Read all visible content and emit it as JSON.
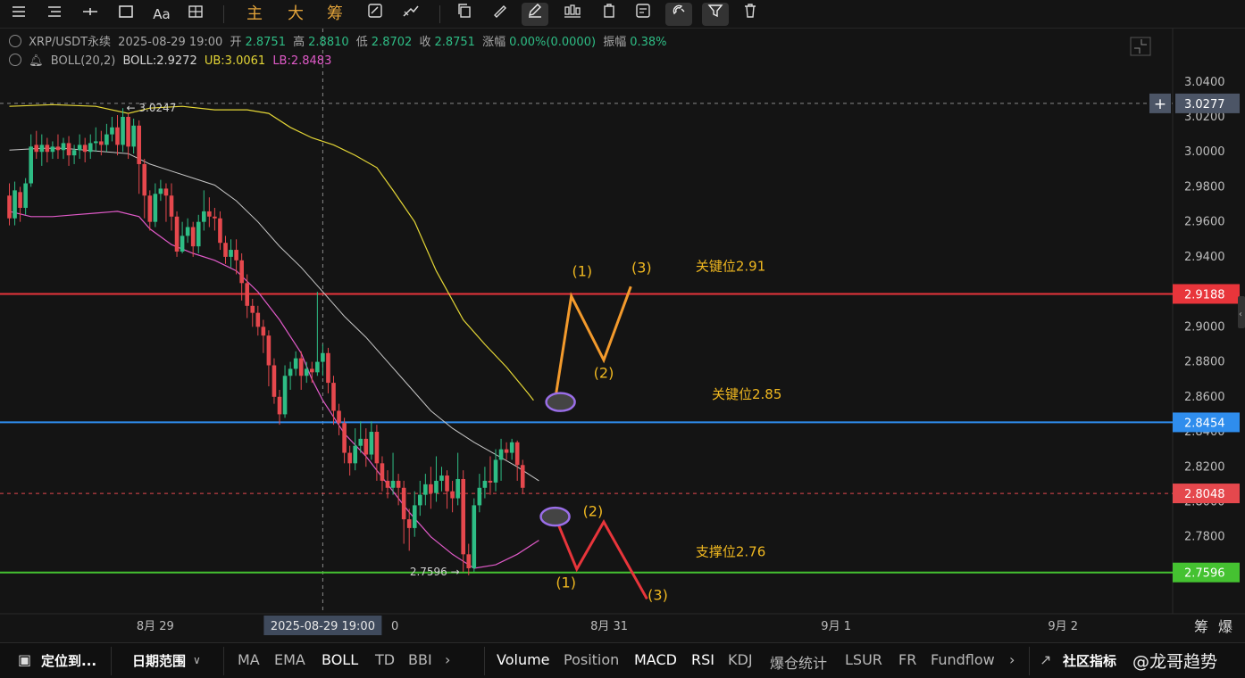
{
  "toolbar": {
    "icons": [
      "menu-icon",
      "list-icon",
      "crosshair-icon",
      "rect-icon",
      "font-size-icon",
      "grid-icon",
      "edit-icon",
      "trend-icon",
      "copy-icon",
      "ruler-icon",
      "pen-icon",
      "candle-icon",
      "clip-icon",
      "note-icon",
      "magnet-icon",
      "filter-icon",
      "trash-icon"
    ],
    "font_label": "Aa",
    "cn_buttons": [
      "主",
      "大",
      "筹"
    ]
  },
  "legend": {
    "symbol": "XRP/USDT永续",
    "datetime": "2025-08-29 19:00",
    "open_label": "开",
    "open": "2.8751",
    "high_label": "高",
    "high": "2.8810",
    "low_label": "低",
    "low": "2.8702",
    "close_label": "收",
    "close": "2.8751",
    "change_label": "涨幅",
    "change": "0.00%(0.0000)",
    "amp_label": "振幅",
    "amp": "0.38%",
    "boll_name": "BOLL(20,2)",
    "boll_mid": "BOLL:2.9272",
    "boll_ub": "UB:3.0061",
    "boll_lb": "LB:2.8483"
  },
  "colors": {
    "up": "#2ebd85",
    "down": "#e5484d",
    "ub": "#e4d636",
    "mid": "#c8c8c8",
    "lb": "#e05ac8",
    "resistance": "#e8353b",
    "key": "#2f8ded",
    "support": "#45c231",
    "annotation": "#f0b820",
    "orange_path": "#f39a2c",
    "red_path": "#e8353b",
    "ellipse": "#9a6ee8",
    "text": "#d6d6d6"
  },
  "chart_data": {
    "type": "candlestick",
    "ylim": [
      2.736,
      3.046
    ],
    "y_ticks": [
      "3.0400",
      "3.0200",
      "3.0000",
      "2.9800",
      "2.9600",
      "2.9400",
      "2.9200",
      "2.9000",
      "2.8800",
      "2.8600",
      "2.8400",
      "2.8200",
      "2.8000",
      "2.7800"
    ],
    "x_labels": [
      {
        "index": 27,
        "label": "8月 29"
      },
      {
        "index": 58,
        "label": "2025-08-29 19:00",
        "highlight": true
      },
      {
        "index": 111,
        "label": "8月 31"
      },
      {
        "index": 153,
        "label": "9月 1"
      },
      {
        "index": 195,
        "label": "9月 2"
      }
    ],
    "crosshair_index": 58,
    "crosshair_price_label": "3.0277",
    "crosshair_price": 3.0277,
    "max_marker": {
      "index": 21,
      "label": "3.0247"
    },
    "min_marker": {
      "index": 84,
      "label": "2.7596"
    },
    "candles": [
      [
        2.975,
        2.962,
        2.982,
        2.958
      ],
      [
        2.962,
        2.978,
        2.983,
        2.958
      ],
      [
        2.977,
        2.968,
        2.98,
        2.96
      ],
      [
        2.968,
        2.982,
        2.985,
        2.964
      ],
      [
        2.982,
        3.003,
        3.01,
        2.98
      ],
      [
        3.004,
        3.0,
        3.012,
        2.996
      ],
      [
        3.0,
        3.004,
        3.01,
        2.992
      ],
      [
        3.004,
        3.0,
        3.008,
        2.994
      ],
      [
        3.0,
        3.003,
        3.006,
        2.996
      ],
      [
        3.003,
        3.001,
        3.01,
        2.996
      ],
      [
        3.001,
        3.005,
        3.008,
        2.996
      ],
      [
        3.005,
        2.998,
        3.009,
        2.992
      ],
      [
        2.998,
        3.001,
        3.004,
        2.993
      ],
      [
        3.001,
        3.004,
        3.01,
        2.996
      ],
      [
        3.004,
        3.0,
        3.008,
        2.994
      ],
      [
        3.0,
        3.005,
        3.01,
        2.996
      ],
      [
        3.005,
        3.006,
        3.014,
        3.0
      ],
      [
        3.006,
        3.004,
        3.012,
        2.998
      ],
      [
        3.004,
        3.01,
        3.016,
        3.0
      ],
      [
        3.01,
        3.014,
        3.02,
        3.006
      ],
      [
        3.014,
        3.004,
        3.021,
        2.998
      ],
      [
        3.004,
        3.02,
        3.025,
        3.0
      ],
      [
        3.02,
        3.003,
        3.022,
        2.996
      ],
      [
        3.003,
        3.015,
        3.019,
        2.999
      ],
      [
        3.015,
        2.993,
        3.018,
        2.976
      ],
      [
        2.993,
        2.975,
        2.996,
        2.962
      ],
      [
        2.975,
        2.96,
        2.978,
        2.955
      ],
      [
        2.96,
        2.976,
        2.982,
        2.957
      ],
      [
        2.976,
        2.979,
        2.984,
        2.972
      ],
      [
        2.979,
        2.975,
        2.982,
        2.96
      ],
      [
        2.975,
        2.963,
        2.982,
        2.955
      ],
      [
        2.963,
        2.943,
        2.966,
        2.94
      ],
      [
        2.943,
        2.952,
        2.96,
        2.942
      ],
      [
        2.952,
        2.957,
        2.962,
        2.948
      ],
      [
        2.957,
        2.946,
        2.96,
        2.94
      ],
      [
        2.946,
        2.96,
        2.964,
        2.942
      ],
      [
        2.96,
        2.966,
        2.978,
        2.955
      ],
      [
        2.966,
        2.963,
        2.974,
        2.957
      ],
      [
        2.963,
        2.962,
        2.968,
        2.955
      ],
      [
        2.962,
        2.948,
        2.966,
        2.944
      ],
      [
        2.948,
        2.94,
        2.952,
        2.936
      ],
      [
        2.94,
        2.944,
        2.95,
        2.934
      ],
      [
        2.944,
        2.938,
        2.95,
        2.93
      ],
      [
        2.938,
        2.925,
        2.942,
        2.915
      ],
      [
        2.925,
        2.912,
        2.93,
        2.905
      ],
      [
        2.912,
        2.908,
        2.916,
        2.9
      ],
      [
        2.908,
        2.9,
        2.912,
        2.895
      ],
      [
        2.9,
        2.895,
        2.904,
        2.885
      ],
      [
        2.895,
        2.878,
        2.898,
        2.866
      ],
      [
        2.878,
        2.86,
        2.882,
        2.856
      ],
      [
        2.86,
        2.85,
        2.864,
        2.844
      ],
      [
        2.85,
        2.872,
        2.878,
        2.848
      ],
      [
        2.872,
        2.876,
        2.88,
        2.864
      ],
      [
        2.876,
        2.882,
        2.886,
        2.872
      ],
      [
        2.882,
        2.872,
        2.886,
        2.864
      ],
      [
        2.872,
        2.876,
        2.88,
        2.868
      ],
      [
        2.876,
        2.874,
        2.88,
        2.868
      ],
      [
        2.874,
        2.88,
        2.92,
        2.872
      ],
      [
        2.88,
        2.885,
        2.89,
        2.872
      ],
      [
        2.885,
        2.868,
        2.888,
        2.862
      ],
      [
        2.868,
        2.852,
        2.872,
        2.844
      ],
      [
        2.852,
        2.845,
        2.856,
        2.838
      ],
      [
        2.845,
        2.828,
        2.848,
        2.822
      ],
      [
        2.828,
        2.822,
        2.832,
        2.815
      ],
      [
        2.822,
        2.832,
        2.842,
        2.818
      ],
      [
        2.832,
        2.836,
        2.846,
        2.828
      ],
      [
        2.836,
        2.827,
        2.842,
        2.82
      ],
      [
        2.827,
        2.84,
        2.846,
        2.824
      ],
      [
        2.84,
        2.822,
        2.844,
        2.812
      ],
      [
        2.822,
        2.812,
        2.826,
        2.806
      ],
      [
        2.812,
        2.808,
        2.818,
        2.802
      ],
      [
        2.808,
        2.812,
        2.828,
        2.804
      ],
      [
        2.812,
        2.808,
        2.816,
        2.798
      ],
      [
        2.808,
        2.79,
        2.812,
        2.776
      ],
      [
        2.79,
        2.785,
        2.796,
        2.772
      ],
      [
        2.785,
        2.798,
        2.806,
        2.78
      ],
      [
        2.798,
        2.804,
        2.812,
        2.792
      ],
      [
        2.804,
        2.81,
        2.816,
        2.798
      ],
      [
        2.81,
        2.805,
        2.82,
        2.796
      ],
      [
        2.805,
        2.812,
        2.826,
        2.8
      ],
      [
        2.812,
        2.815,
        2.82,
        2.806
      ],
      [
        2.815,
        2.806,
        2.818,
        2.796
      ],
      [
        2.806,
        2.802,
        2.812,
        2.794
      ],
      [
        2.802,
        2.813,
        2.828,
        2.798
      ],
      [
        2.813,
        2.77,
        2.818,
        2.76
      ],
      [
        2.77,
        2.762,
        2.776,
        2.758
      ],
      [
        2.762,
        2.798,
        2.802,
        2.76
      ],
      [
        2.798,
        2.808,
        2.816,
        2.794
      ],
      [
        2.808,
        2.812,
        2.82,
        2.802
      ],
      [
        2.812,
        2.811,
        2.826,
        2.804
      ],
      [
        2.811,
        2.824,
        2.83,
        2.806
      ],
      [
        2.824,
        2.83,
        2.836,
        2.812
      ],
      [
        2.83,
        2.828,
        2.834,
        2.824
      ],
      [
        2.828,
        2.834,
        2.836,
        2.824
      ],
      [
        2.834,
        2.821,
        2.835,
        2.812
      ],
      [
        2.821,
        2.808,
        2.824,
        2.805
      ]
    ],
    "bands": {
      "ub": [
        [
          0,
          3.026
        ],
        [
          8,
          3.027
        ],
        [
          16,
          3.026
        ],
        [
          22,
          3.022
        ],
        [
          26,
          3.025
        ],
        [
          32,
          3.026
        ],
        [
          38,
          3.024
        ],
        [
          44,
          3.024
        ],
        [
          48,
          3.022
        ],
        [
          52,
          3.014
        ],
        [
          56,
          3.008
        ],
        [
          60,
          3.004
        ],
        [
          64,
          2.998
        ],
        [
          68,
          2.991
        ],
        [
          71,
          2.978
        ],
        [
          75,
          2.96
        ],
        [
          79,
          2.932
        ],
        [
          84,
          2.904
        ],
        [
          88,
          2.89
        ],
        [
          92,
          2.877
        ],
        [
          96,
          2.862
        ],
        [
          97,
          2.858
        ]
      ],
      "mid": [
        [
          0,
          3.001
        ],
        [
          6,
          3.002
        ],
        [
          10,
          3.002
        ],
        [
          14,
          3.001
        ],
        [
          18,
          3.0
        ],
        [
          22,
          2.999
        ],
        [
          24,
          2.996
        ],
        [
          26,
          2.993
        ],
        [
          30,
          2.989
        ],
        [
          34,
          2.985
        ],
        [
          38,
          2.981
        ],
        [
          42,
          2.972
        ],
        [
          46,
          2.96
        ],
        [
          50,
          2.946
        ],
        [
          54,
          2.934
        ],
        [
          58,
          2.92
        ],
        [
          62,
          2.906
        ],
        [
          66,
          2.894
        ],
        [
          70,
          2.88
        ],
        [
          74,
          2.866
        ],
        [
          78,
          2.852
        ],
        [
          82,
          2.842
        ],
        [
          86,
          2.834
        ],
        [
          90,
          2.827
        ],
        [
          94,
          2.82
        ],
        [
          98,
          2.812
        ]
      ],
      "lb": [
        [
          0,
          2.966
        ],
        [
          4,
          2.963
        ],
        [
          8,
          2.963
        ],
        [
          12,
          2.964
        ],
        [
          16,
          2.965
        ],
        [
          20,
          2.966
        ],
        [
          24,
          2.963
        ],
        [
          26,
          2.956
        ],
        [
          30,
          2.947
        ],
        [
          34,
          2.942
        ],
        [
          38,
          2.938
        ],
        [
          42,
          2.932
        ],
        [
          46,
          2.92
        ],
        [
          50,
          2.904
        ],
        [
          54,
          2.885
        ],
        [
          56,
          2.87
        ],
        [
          58,
          2.858
        ],
        [
          62,
          2.839
        ],
        [
          66,
          2.826
        ],
        [
          70,
          2.81
        ],
        [
          74,
          2.794
        ],
        [
          78,
          2.78
        ],
        [
          82,
          2.77
        ],
        [
          86,
          2.762
        ],
        [
          90,
          2.764
        ],
        [
          94,
          2.77
        ],
        [
          98,
          2.778
        ]
      ]
    },
    "hlines": [
      {
        "price": 2.9188,
        "label": "2.9188",
        "style": "resistance",
        "text": "关键位2.91",
        "text_index": 127,
        "text_price": 2.9345
      },
      {
        "price": 2.8454,
        "label": "2.8454",
        "style": "key",
        "text": "关键位2.85",
        "text_index": 130,
        "text_price": 2.8615
      },
      {
        "price": 2.8048,
        "label": "2.8048",
        "style": "current",
        "text": "",
        "text_index": 0,
        "text_price": 0
      },
      {
        "price": 2.7596,
        "label": "2.7596",
        "style": "support",
        "text": "支撑位2.76",
        "text_index": 127,
        "text_price": 2.7715
      }
    ],
    "paths": {
      "orange": [
        [
          101,
          2.858
        ],
        [
          104,
          2.9175
        ],
        [
          110,
          2.881
        ],
        [
          115,
          2.923
        ]
      ],
      "red": [
        [
          101,
          2.7915
        ],
        [
          105,
          2.7615
        ],
        [
          110,
          2.7885
        ],
        [
          118,
          2.7445
        ]
      ]
    },
    "ellipses": [
      {
        "index": 102,
        "price": 2.857
      },
      {
        "index": 101,
        "price": 2.7915
      }
    ],
    "annotations": [
      {
        "text": "(1)",
        "index": 106,
        "price": 2.9315,
        "path": "orange"
      },
      {
        "text": "(2)",
        "index": 110,
        "price": 2.8735,
        "path": "orange"
      },
      {
        "text": "(3)",
        "index": 117,
        "price": 2.9335,
        "path": "orange"
      },
      {
        "text": "(2)",
        "index": 108,
        "price": 2.7945,
        "path": "red"
      },
      {
        "text": "(1)",
        "index": 103,
        "price": 2.7535,
        "path": "red"
      },
      {
        "text": "(3)",
        "index": 120,
        "price": 2.7465,
        "path": "red"
      }
    ]
  },
  "right_corner": [
    "筹",
    "爆"
  ],
  "bottom": {
    "locate": "定位到...",
    "range": "日期范围",
    "indicators": [
      "MA",
      "EMA",
      "BOLL",
      "TD",
      "BBI"
    ],
    "active_indicator": "BOLL",
    "sub_indicators": [
      "Volume",
      "Position",
      "MACD",
      "RSI",
      "KDJ",
      "爆仓统计",
      "LSUR",
      "FR",
      "Fundflow"
    ],
    "active_sub": [
      "Volume",
      "MACD",
      "RSI"
    ],
    "community": "社区指标",
    "watermark": "@龙哥趋势"
  }
}
